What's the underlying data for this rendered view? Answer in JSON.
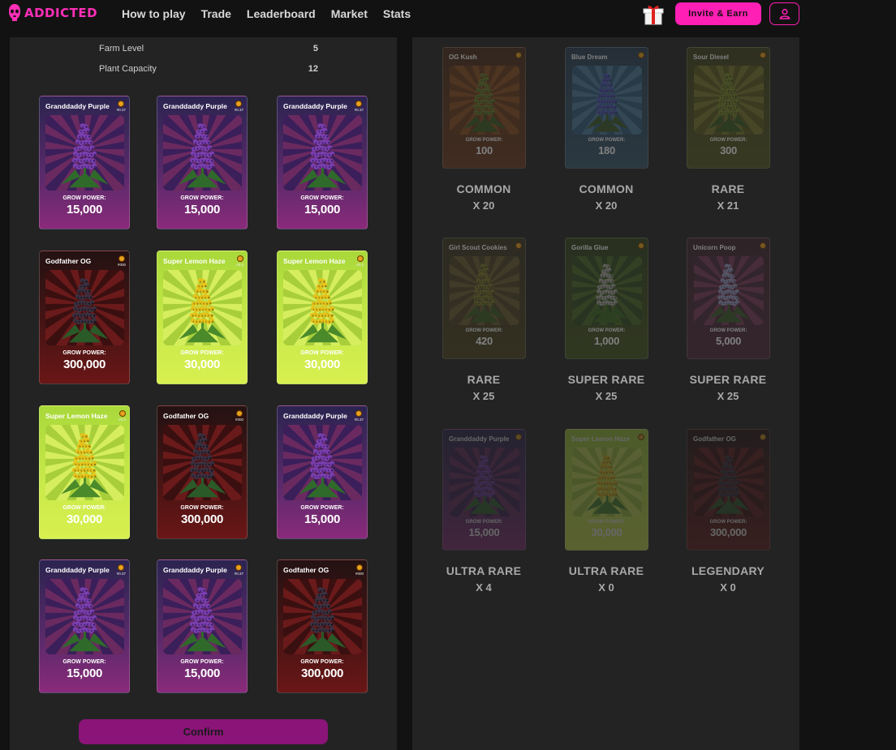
{
  "brand": {
    "name": "ADDICTED",
    "accent": "#ff1fb4"
  },
  "nav": {
    "items": [
      "How to play",
      "Trade",
      "Leaderboard",
      "Market",
      "Stats"
    ],
    "invite_label": "Invite & Earn"
  },
  "farm": {
    "level_label": "Farm Level",
    "level_value": "5",
    "capacity_label": "Plant Capacity",
    "capacity_value": "12"
  },
  "grow_power_label": "GROW POWER:",
  "selected_cards": [
    {
      "name": "Granddaddy Purple",
      "num": "#0.37",
      "power": "15,000",
      "theme": "purple"
    },
    {
      "name": "Granddaddy Purple",
      "num": "#0.37",
      "power": "15,000",
      "theme": "purple"
    },
    {
      "name": "Granddaddy Purple",
      "num": "#0.37",
      "power": "15,000",
      "theme": "purple"
    },
    {
      "name": "Godfather OG",
      "num": "#000",
      "power": "300,000",
      "theme": "red"
    },
    {
      "name": "Super Lemon Haze",
      "num": "#2.0",
      "power": "30,000",
      "theme": "lime"
    },
    {
      "name": "Super Lemon Haze",
      "num": "#2.0",
      "power": "30,000",
      "theme": "lime"
    },
    {
      "name": "Super Lemon Haze",
      "num": "#2.0",
      "power": "30,000",
      "theme": "lime"
    },
    {
      "name": "Godfather OG",
      "num": "#000",
      "power": "300,000",
      "theme": "red"
    },
    {
      "name": "Granddaddy Purple",
      "num": "#0.37",
      "power": "15,000",
      "theme": "purple"
    },
    {
      "name": "Granddaddy Purple",
      "num": "#0.37",
      "power": "15,000",
      "theme": "purple"
    },
    {
      "name": "Granddaddy Purple",
      "num": "#0.37",
      "power": "15,000",
      "theme": "purple"
    },
    {
      "name": "Godfather OG",
      "num": "#000",
      "power": "300,000",
      "theme": "red"
    }
  ],
  "confirm_label": "Confirm",
  "collection": [
    {
      "name": "OG Kush",
      "power": "100",
      "rarity": "COMMON",
      "count": "X 20",
      "theme": "orange",
      "dim": true
    },
    {
      "name": "Blue Dream",
      "power": "180",
      "rarity": "COMMON",
      "count": "X 20",
      "theme": "blue",
      "dim": true
    },
    {
      "name": "Sour Diesel",
      "power": "300",
      "rarity": "RARE",
      "count": "X 21",
      "theme": "olive",
      "dim": true
    },
    {
      "name": "Girl Scout Cookies",
      "power": "420",
      "rarity": "RARE",
      "count": "X 25",
      "theme": "khaki",
      "dim": true
    },
    {
      "name": "Gorilla Glue",
      "power": "1,000",
      "rarity": "SUPER RARE",
      "count": "X 25",
      "theme": "green",
      "dim": true
    },
    {
      "name": "Unicorn Poop",
      "power": "5,000",
      "rarity": "SUPER RARE",
      "count": "X 25",
      "theme": "rose",
      "dim": true
    },
    {
      "name": "Granddaddy Purple",
      "power": "15,000",
      "rarity": "ULTRA RARE",
      "count": "X 4",
      "theme": "purple",
      "dim": true
    },
    {
      "name": "Super Lemon Haze",
      "power": "30,000",
      "rarity": "ULTRA RARE",
      "count": "X 0",
      "theme": "lime",
      "dim": true
    },
    {
      "name": "Godfather OG",
      "power": "300,000",
      "rarity": "LEGENDARY",
      "count": "X 0",
      "theme": "red",
      "dim": true
    }
  ]
}
